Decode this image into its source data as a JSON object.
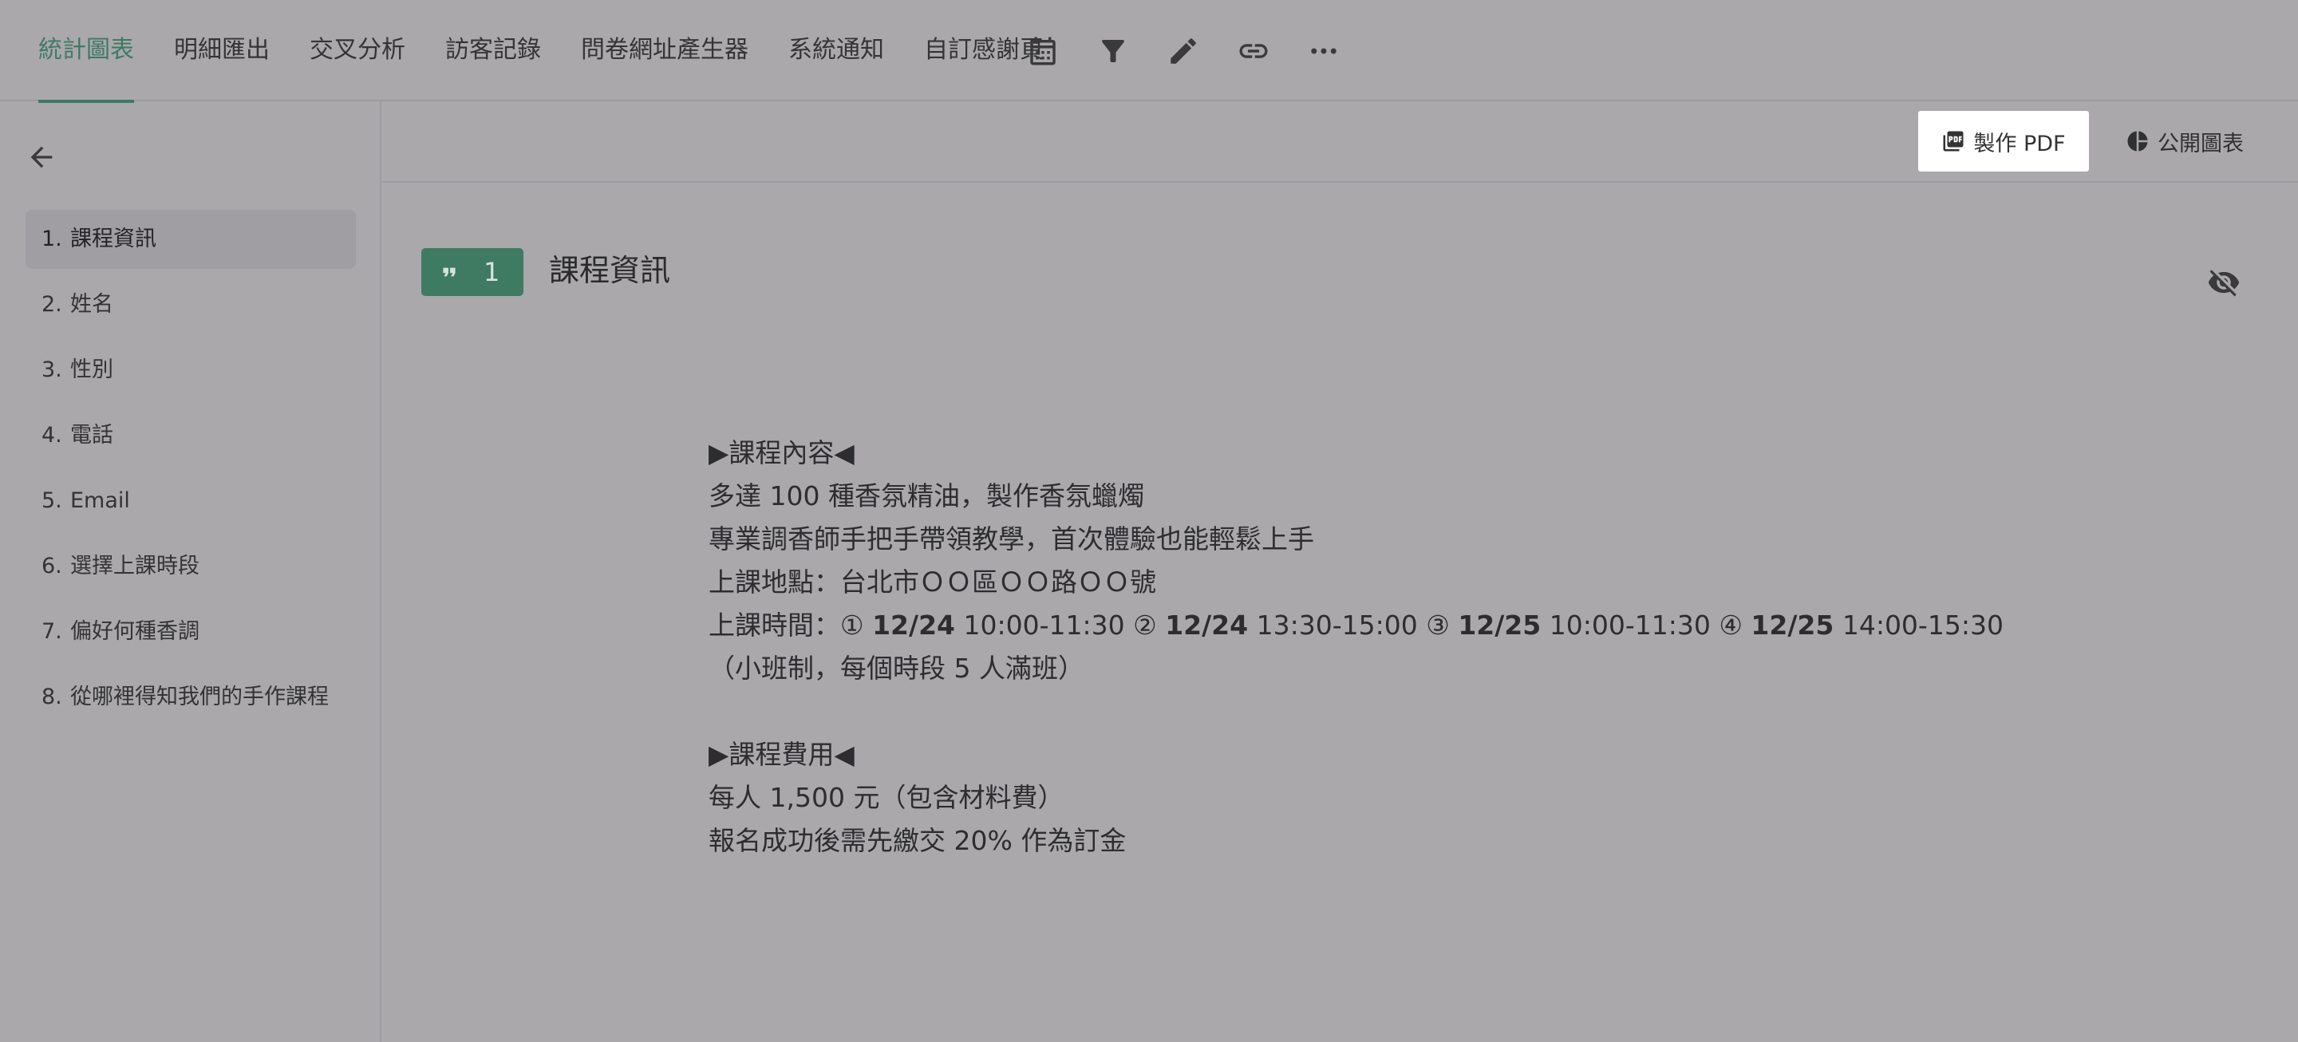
{
  "tabs": [
    {
      "label": "統計圖表",
      "active": true
    },
    {
      "label": "明細匯出"
    },
    {
      "label": "交叉分析"
    },
    {
      "label": "訪客記錄"
    },
    {
      "label": "問卷網址產生器"
    },
    {
      "label": "系統通知"
    },
    {
      "label": "自訂感謝頁"
    }
  ],
  "toolbar_icons": [
    "calendar-icon",
    "filter-icon",
    "edit-icon",
    "link-icon",
    "more-icon"
  ],
  "sidebar": {
    "questions": [
      {
        "num": "1.",
        "label": "課程資訊",
        "active": true
      },
      {
        "num": "2.",
        "label": "姓名"
      },
      {
        "num": "3.",
        "label": "性別"
      },
      {
        "num": "4.",
        "label": "電話"
      },
      {
        "num": "5.",
        "label": "Email"
      },
      {
        "num": "6.",
        "label": "選擇上課時段"
      },
      {
        "num": "7.",
        "label": "偏好何種香調"
      },
      {
        "num": "8.",
        "label": "從哪裡得知我們的手作課程"
      }
    ]
  },
  "actions": {
    "pdf_label": "製作 PDF",
    "public_label": "公開圖表"
  },
  "question": {
    "number": "1",
    "title": "課程資訊"
  },
  "description": {
    "lines": [
      "▶課程內容◀",
      "多達 100 種香氛精油，製作香氛蠟燭",
      "專業調香師手把手帶領教學，首次體驗也能輕鬆上手",
      "上課地點：台北市ＯＯ區ＯＯ路ＯＯ號",
      "",
      "（小班制，每個時段 5 人滿班）",
      "",
      "▶課程費用◀",
      "每人 1,500 元（包含材料費）",
      "報名成功後需先繳交 20% 作為訂金"
    ],
    "schedule_line": {
      "prefix": "上課時間：",
      "slots": [
        {
          "mark": "①",
          "date": "12/24",
          "time": "10:00-11:30"
        },
        {
          "mark": "②",
          "date": "12/24",
          "time": "13:30-15:00"
        },
        {
          "mark": "③",
          "date": "12/25",
          "time": "10:00-11:30"
        },
        {
          "mark": "④",
          "date": "12/25",
          "time": "14:00-15:30"
        }
      ]
    }
  },
  "colors": {
    "overlay_background": "#aaa8ab",
    "accent_green": "#3e7a63",
    "pdf_button_background": "#ffffff"
  }
}
